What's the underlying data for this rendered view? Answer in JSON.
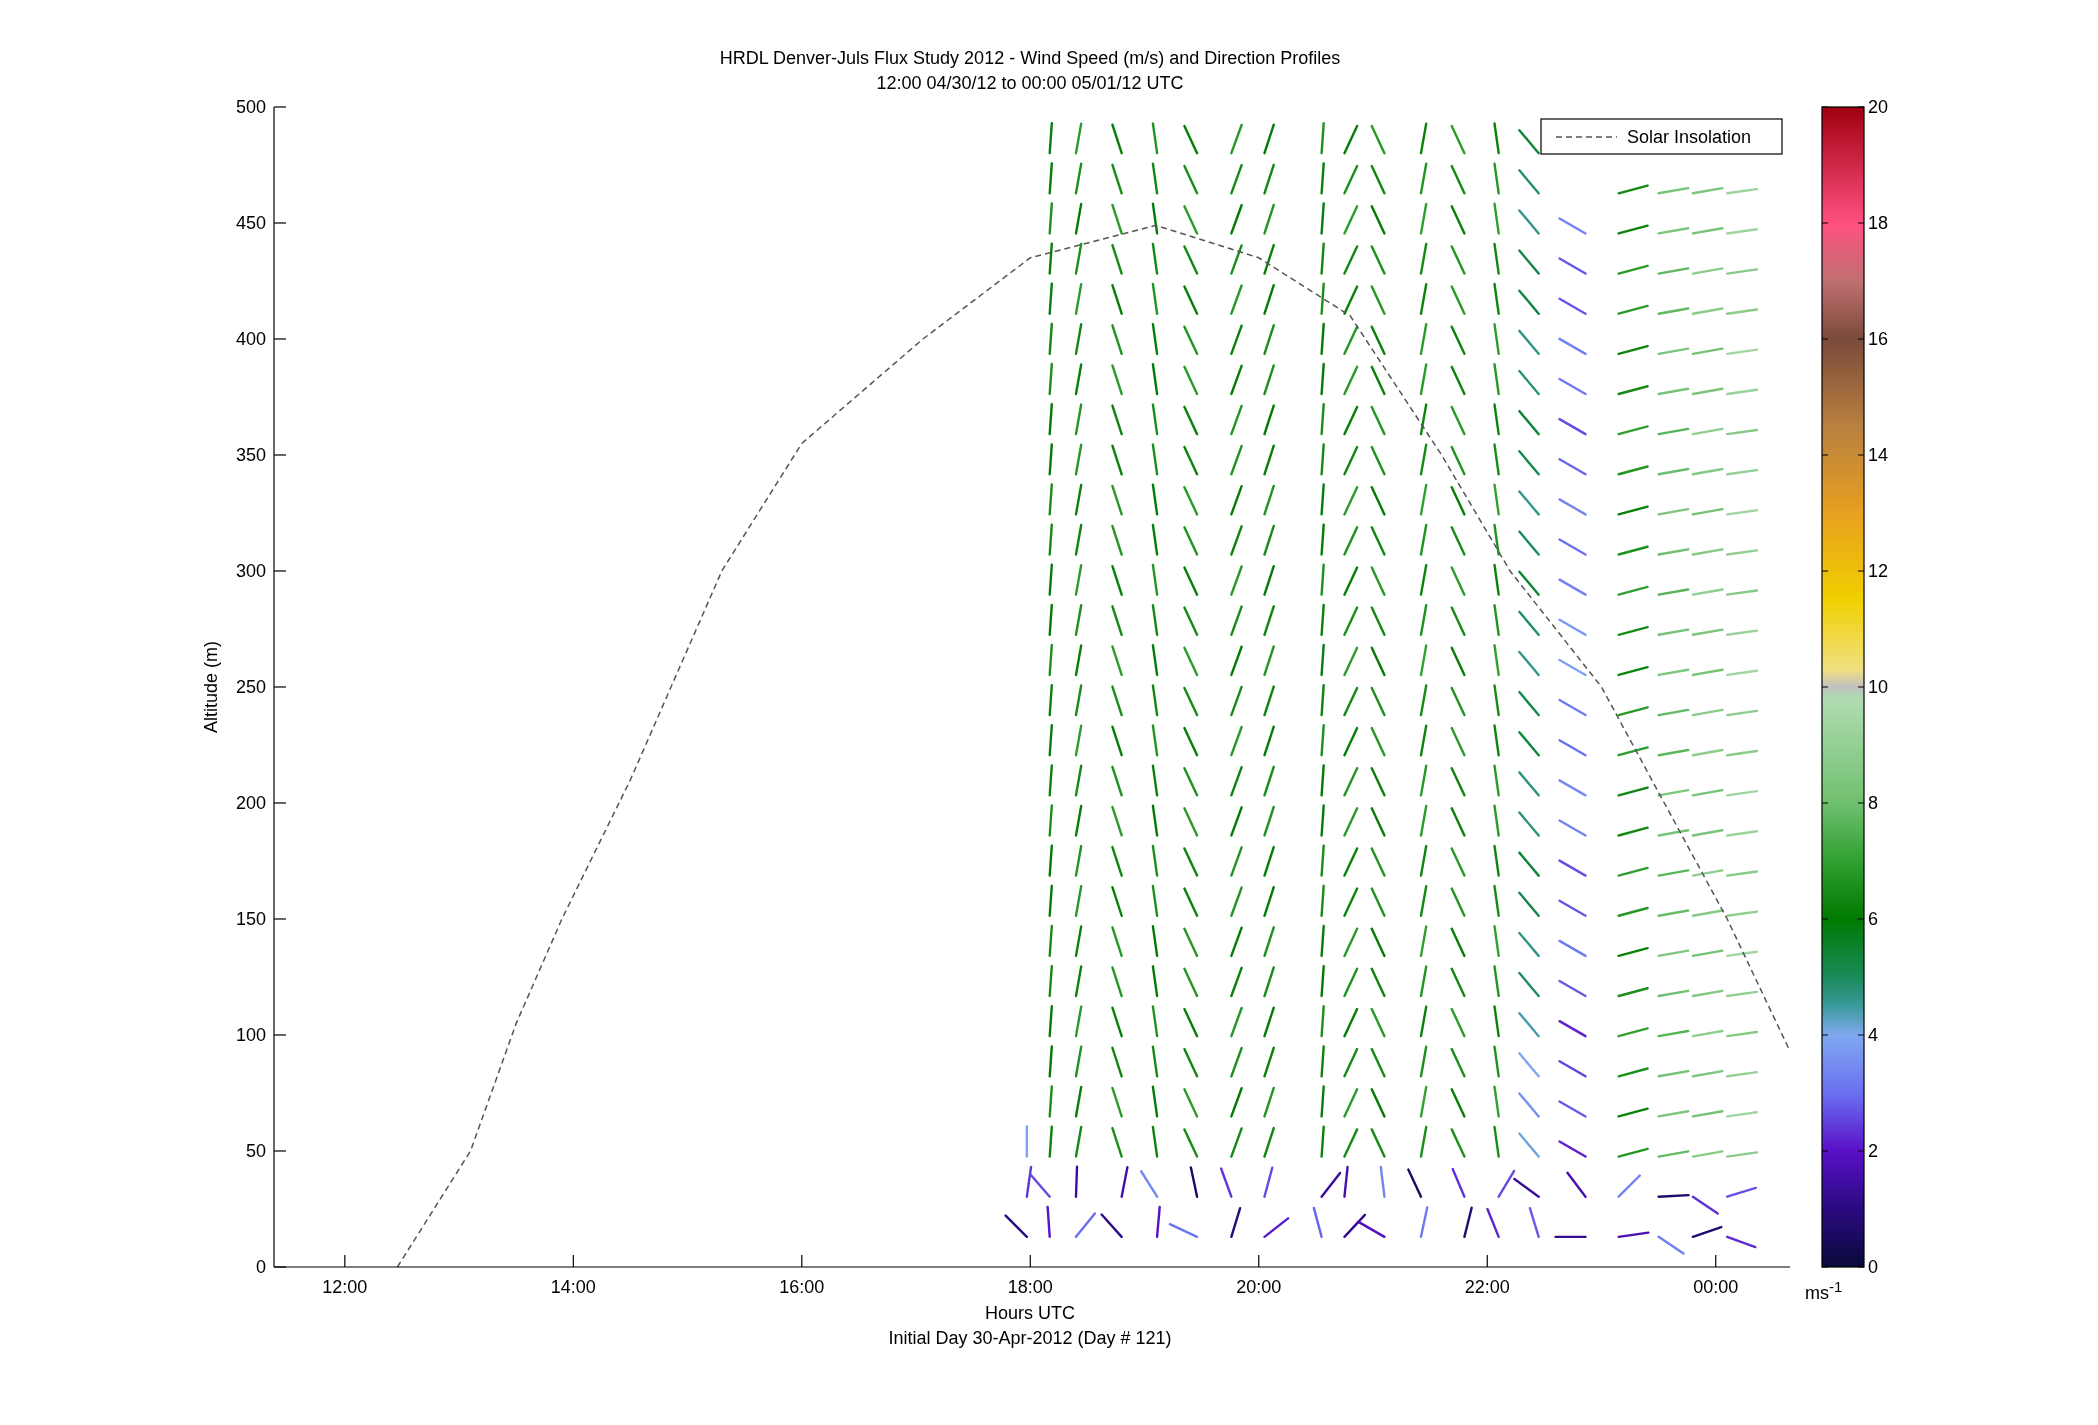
{
  "figure": {
    "title": "HRDL Denver-Juls Flux Study 2012 - Wind Speed (m/s) and Direction Profiles",
    "subtitle": "12:00 04/30/12 to 00:00 05/01/12  UTC",
    "footnote": "Initial Day 30-Apr-2012 (Day # 121)"
  },
  "chart_data": {
    "type": "line",
    "xlabel": "Hours UTC",
    "ylabel": "Altitude (m)",
    "xlim": [
      11.38,
      24.65
    ],
    "ylim": [
      0,
      500
    ],
    "xticks": [
      {
        "value": 12,
        "label": "12:00"
      },
      {
        "value": 14,
        "label": "14:00"
      },
      {
        "value": 16,
        "label": "16:00"
      },
      {
        "value": 18,
        "label": "18:00"
      },
      {
        "value": 20,
        "label": "20:00"
      },
      {
        "value": 22,
        "label": "22:00"
      },
      {
        "value": 24,
        "label": "00:00"
      }
    ],
    "yticks": [
      0,
      50,
      100,
      150,
      200,
      250,
      300,
      350,
      400,
      450,
      500
    ],
    "x": [
      12.46,
      13.1,
      13.5,
      13.9,
      14.5,
      15.3,
      16,
      17.06,
      18,
      19.1,
      20,
      20.8,
      21.6,
      22.2,
      23,
      23.55,
      24.1,
      24.65
    ],
    "series": [
      {
        "name": "Solar Insolation",
        "color": "#555555",
        "line_style": "dashed",
        "values": [
          0,
          50,
          105,
          150,
          210,
          300,
          355,
          400,
          435,
          449,
          435,
          410,
          350,
          300,
          250,
          200,
          150,
          93
        ]
      }
    ]
  },
  "colorbar": {
    "ticks": [
      "20",
      "18",
      "16",
      "14",
      "12",
      "10",
      "8",
      "6",
      "4",
      "2",
      "0"
    ],
    "unit": "ms$^{-1}$"
  }
}
